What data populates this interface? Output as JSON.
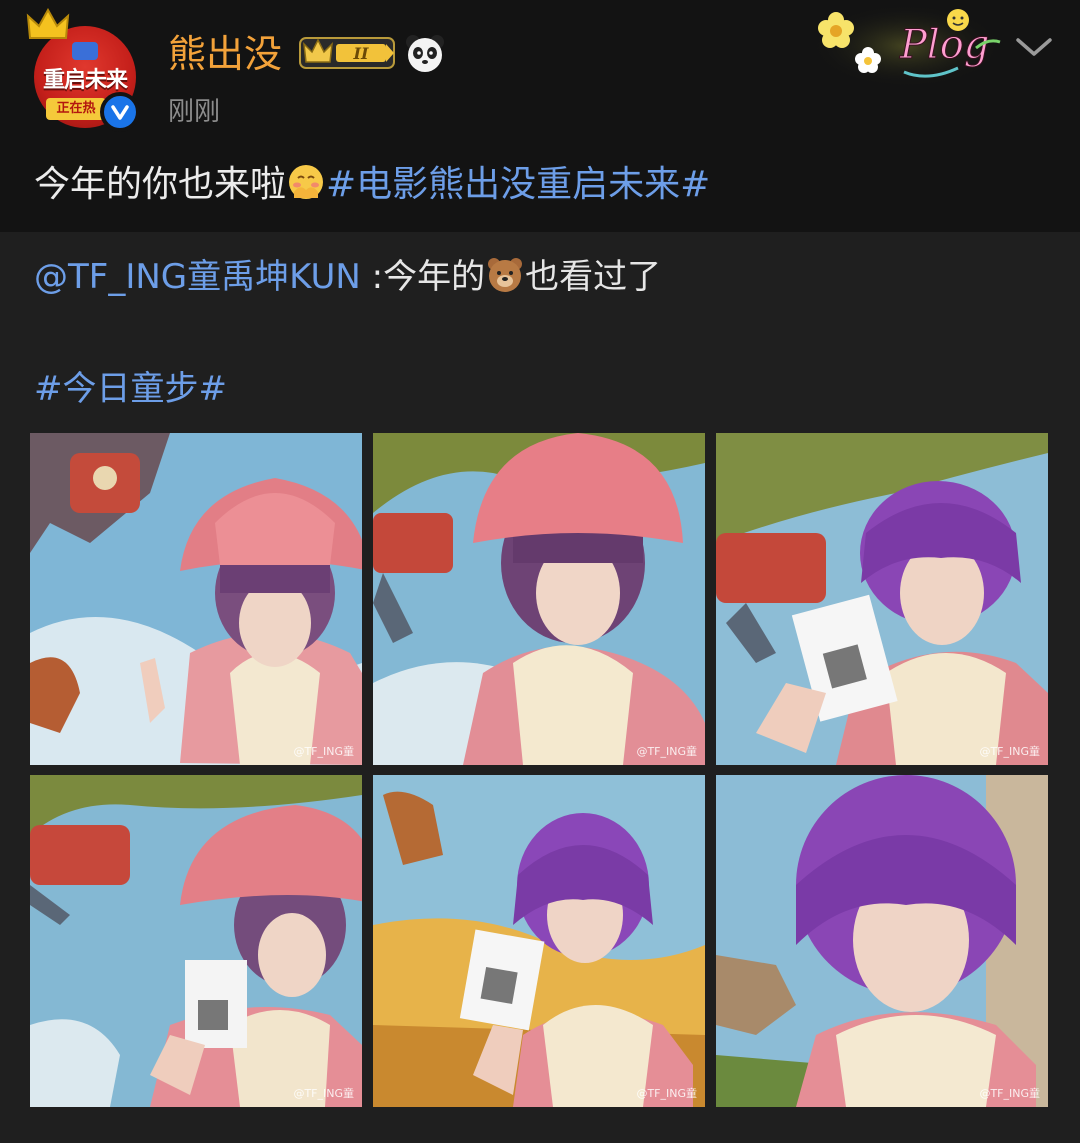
{
  "author": {
    "name": "熊出没",
    "timestamp": "刚刚",
    "avatar_line1": "重启未来",
    "avatar_line2": "正在热",
    "vip_badge": "II"
  },
  "header": {
    "plog_label": "Plog"
  },
  "post": {
    "text": "今年的你也来啦",
    "hashtag": "#电影熊出没重启未来#"
  },
  "repost": {
    "mention": "@TF_ING童禹坤KUN",
    "text_before": " :今年的",
    "text_after": "也看过了",
    "hashtag": "#今日童步#"
  },
  "photos": [
    {
      "watermark": "@TF_ING童",
      "hat": true,
      "ticket": false
    },
    {
      "watermark": "@TF_ING童",
      "hat": true,
      "ticket": false
    },
    {
      "watermark": "@TF_ING童",
      "hat": false,
      "ticket": true
    },
    {
      "watermark": "@TF_ING童",
      "hat": true,
      "ticket": true
    },
    {
      "watermark": "@TF_ING童",
      "hat": false,
      "ticket": true
    },
    {
      "watermark": "@TF_ING童",
      "hat": false,
      "ticket": false
    }
  ],
  "icons": {
    "verified": "verified-check-icon",
    "chevron": "chevron-down-icon",
    "panda": "panda-badge-icon",
    "vip": "crown-vip-badge-icon"
  },
  "colors": {
    "username": "#f3a23a",
    "link": "#6d9ee8",
    "background_top": "#131313",
    "background_repost": "#1f1f1f"
  }
}
